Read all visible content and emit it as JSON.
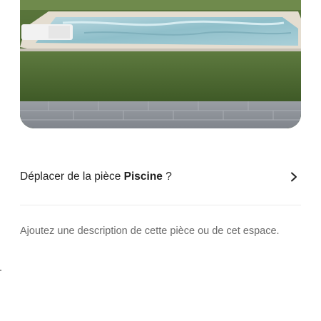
{
  "room_photo": {
    "alt": ""
  },
  "move_room": {
    "prefix": "Déplacer de la pièce",
    "room_name": "Piscine",
    "suffix": "?",
    "icon": "chevron-right-icon"
  },
  "description": {
    "placeholder": "Ajoutez une description de cette pièce ou de cet espace."
  },
  "colors": {
    "text": "#222222",
    "secondary_text": "#6a6a6a",
    "divider": "#ebebeb"
  }
}
